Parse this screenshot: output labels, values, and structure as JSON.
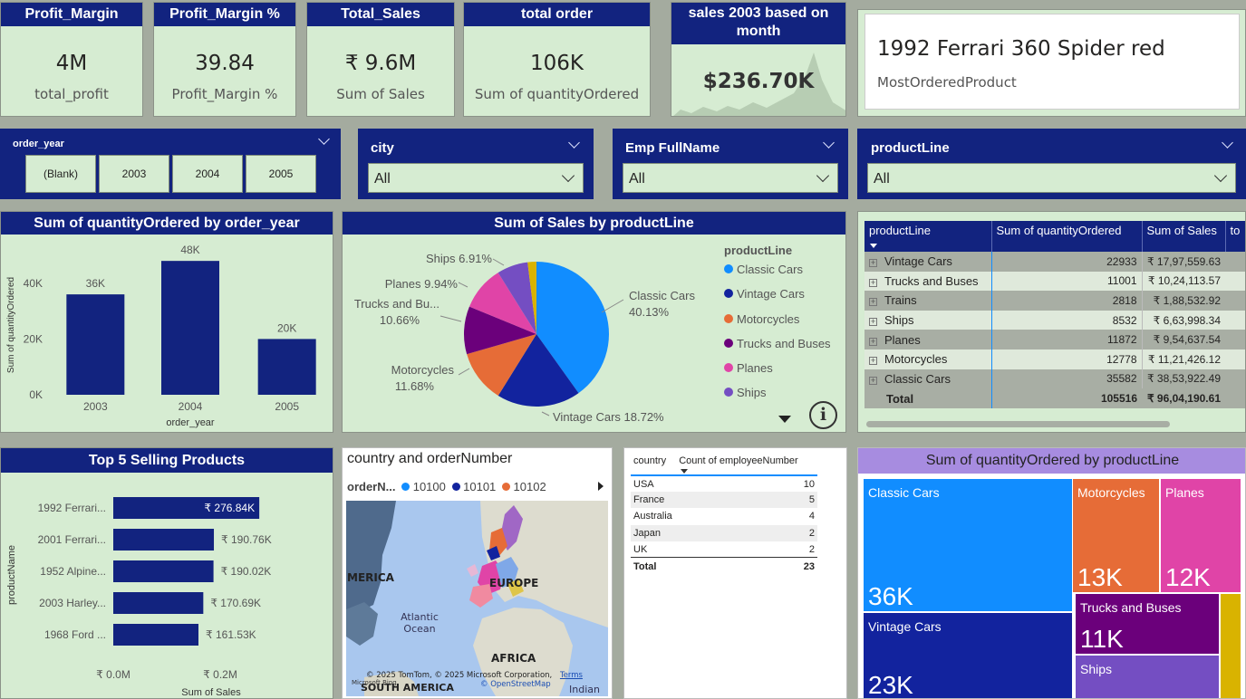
{
  "kpis": [
    {
      "title": "Profit_Margin",
      "value": "4M",
      "label": "total_profit"
    },
    {
      "title": "Profit_Margin %",
      "value": "39.84",
      "label": "Profit_Margin %"
    },
    {
      "title": "Total_Sales",
      "value": "₹ 9.6M",
      "label": "Sum of Sales"
    },
    {
      "title": "total order",
      "value": "106K",
      "label": "Sum of quantityOrdered"
    },
    {
      "title": "sales 2003 based on month",
      "value": "$236.70K"
    }
  ],
  "most_ordered": {
    "value": "1992 Ferrari 360 Spider red",
    "label": "MostOrderedProduct"
  },
  "slicers": {
    "order_year": {
      "title": "order_year",
      "options": [
        "(Blank)",
        "2003",
        "2004",
        "2005"
      ]
    },
    "city": {
      "title": "city",
      "value": "All"
    },
    "emp": {
      "title": "Emp FullName",
      "value": "All"
    },
    "productline": {
      "title": "productLine",
      "value": "All"
    }
  },
  "chart_data": [
    {
      "type": "bar",
      "title": "Sum of quantityOrdered by order_year",
      "xlabel": "order_year",
      "ylabel": "Sum of quantityOrdered",
      "categories": [
        "2003",
        "2004",
        "2005"
      ],
      "values": [
        36000,
        48000,
        20000
      ],
      "data_labels": [
        "36K",
        "48K",
        "20K"
      ],
      "ylim": [
        0,
        50000
      ],
      "yticks": [
        "0K",
        "20K",
        "40K"
      ]
    },
    {
      "type": "pie",
      "title": "Sum of Sales by productLine",
      "legend_title": "productLine",
      "categories": [
        "Classic Cars",
        "Vintage Cars",
        "Motorcycles",
        "Trucks and Buses",
        "Planes",
        "Ships",
        "Trains"
      ],
      "values": [
        40.13,
        18.72,
        11.68,
        10.66,
        9.94,
        6.91,
        1.96
      ],
      "labels": [
        "Classic Cars 40.13%",
        "Vintage Cars 18.72%",
        "Motorcycles 11.68%",
        "Trucks and Bu... 10.66%",
        "Planes 9.94%",
        "Ships 6.91%",
        ""
      ],
      "legend": [
        "Classic Cars",
        "Vintage Cars",
        "Motorcycles",
        "Trucks and Buses",
        "Planes",
        "Ships"
      ],
      "colors": [
        "#118dff",
        "#12239e",
        "#e66c37",
        "#6b007b",
        "#e044a7",
        "#744ec2",
        "#d9b300"
      ]
    },
    {
      "type": "bar",
      "orientation": "horizontal",
      "title": "Top 5 Selling Products",
      "xlabel": "Sum of Sales",
      "ylabel": "productName",
      "categories": [
        "1992 Ferrari...",
        "2001 Ferrari...",
        "1952 Alpine...",
        "2003 Harley...",
        "1968 Ford ..."
      ],
      "values": [
        276840,
        190760,
        190020,
        170690,
        161530
      ],
      "data_labels": [
        "₹ 276.84K",
        "₹ 190.76K",
        "₹ 190.02K",
        "₹ 170.69K",
        "₹ 161.53K"
      ],
      "xticks": [
        "₹ 0.0M",
        "₹ 0.2M"
      ],
      "xlim": [
        0,
        300000
      ]
    },
    {
      "type": "treemap",
      "title": "Sum of quantityOrdered by productLine",
      "categories": [
        "Classic Cars",
        "Vintage Cars",
        "Motorcycles",
        "Planes",
        "Trucks and Buses",
        "Ships",
        "Trains"
      ],
      "values": [
        36000,
        23000,
        13000,
        12000,
        11000,
        8500,
        2800
      ],
      "data_labels": [
        "36K",
        "23K",
        "13K",
        "12K",
        "11K",
        "",
        ""
      ],
      "colors": [
        "#118dff",
        "#12239e",
        "#e66c37",
        "#e044a7",
        "#6b007b",
        "#744ec2",
        "#d9b300"
      ]
    }
  ],
  "matrix": {
    "headers": [
      "productLine",
      "Sum of quantityOrdered",
      "Sum of Sales",
      "to"
    ],
    "rows": [
      [
        "Vintage Cars",
        "22933",
        "₹ 17,97,559.63"
      ],
      [
        "Trucks and Buses",
        "11001",
        "₹ 10,24,113.57"
      ],
      [
        "Trains",
        "2818",
        "₹ 1,88,532.92"
      ],
      [
        "Ships",
        "8532",
        "₹ 6,63,998.34"
      ],
      [
        "Planes",
        "11872",
        "₹ 9,54,637.54"
      ],
      [
        "Motorcycles",
        "12778",
        "₹ 11,21,426.12"
      ],
      [
        "Classic Cars",
        "35582",
        "₹ 38,53,922.49"
      ]
    ],
    "total": [
      "Total",
      "105516",
      "₹ 96,04,190.61"
    ]
  },
  "map": {
    "title": "country and orderNumber",
    "legend_title": "orderN...",
    "legend": [
      {
        "label": "10100",
        "color": "#118dff"
      },
      {
        "label": "10101",
        "color": "#12239e"
      },
      {
        "label": "10102",
        "color": "#e66c37"
      }
    ],
    "labels": {
      "america": "MERICA",
      "europe": "EUROPE",
      "atlantic": "Atlantic Ocean",
      "africa": "AFRICA",
      "south_america": "SOUTH AMERICA",
      "indian": "Indian"
    },
    "attribution": "© 2025 TomTom, © 2025 Microsoft Corporation,",
    "terms": "Terms",
    "osm": "© OpenStreetMap",
    "bing": "Microsoft Bing"
  },
  "country_table": {
    "headers": [
      "country",
      "Count of employeeNumber"
    ],
    "rows": [
      [
        "USA",
        "10"
      ],
      [
        "France",
        "5"
      ],
      [
        "Australia",
        "4"
      ],
      [
        "Japan",
        "2"
      ],
      [
        "UK",
        "2"
      ]
    ],
    "total": [
      "Total",
      "23"
    ]
  }
}
